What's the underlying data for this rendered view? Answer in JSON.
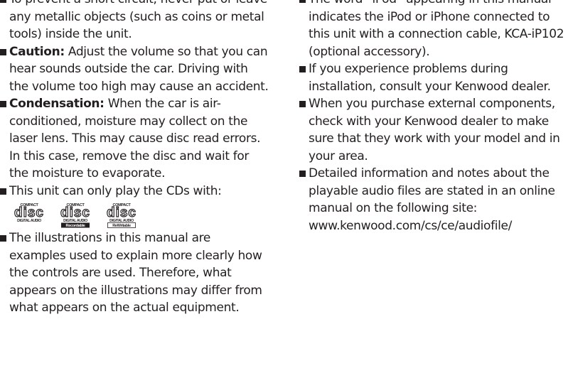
{
  "left": {
    "item0": {
      "line0": "",
      "text": "To prevent a short circuit, never put or leave any metallic objects (such as coins or metal tools) inside the unit."
    },
    "item1": {
      "bold": "Caution:",
      "text": " Adjust the volume so that you can hear sounds outside the car. Driving with the volume too high may cause an accident."
    },
    "item2": {
      "bold": "Condensation:",
      "text": " When the car is air-conditioned, moisture may collect on the laser lens. This may cause disc read errors. In this case, remove the disc and wait for the moisture to evaporate."
    },
    "item3": {
      "text": "This unit can only play the CDs with:"
    },
    "logos": [
      {
        "top": "COMPACT",
        "main": "disc",
        "bottom": "DIGITAL AUDIO",
        "sub": ""
      },
      {
        "top": "COMPACT",
        "main": "disc",
        "bottom": "DIGITAL AUDIO",
        "sub": "Recordable"
      },
      {
        "top": "COMPACT",
        "main": "disc",
        "bottom": "DIGITAL AUDIO",
        "sub": "ReWritable"
      }
    ],
    "item4": {
      "text": "The illustrations in this manual are examples used to explain more clearly how the controls are used. Therefore, what appears on the illustrations may differ from what appears on the actual equipment."
    }
  },
  "right": {
    "item0": {
      "text": "The word “iPod” appearing in this manual indicates the iPod or iPhone connected to this unit with a connection cable, KCA-iP102 (optional accessory)."
    },
    "item1": {
      "text": "If you experience problems during installation, consult your Kenwood dealer."
    },
    "item2": {
      "text": "When you purchase external components, check with your Kenwood dealer to make sure that they work with your model and in your area."
    },
    "item3": {
      "text": "Detailed information and notes about the playable audio files are stated in an online manual on the following site:",
      "url": "www.kenwood.com/cs/ce/audiofile/"
    }
  }
}
